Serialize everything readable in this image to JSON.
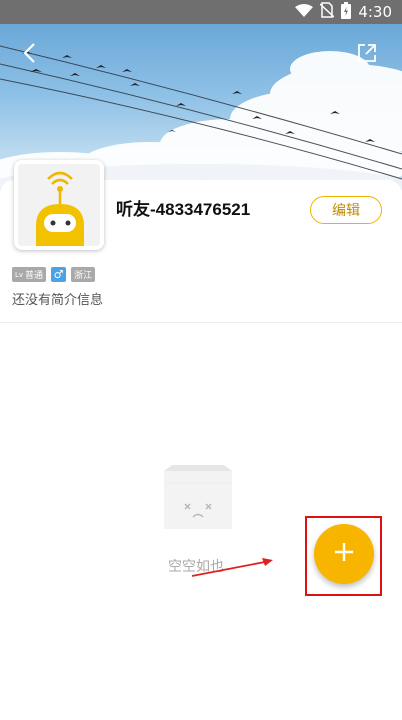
{
  "status_bar": {
    "time": "4:30",
    "icons": [
      "wifi-icon",
      "no-sim-icon",
      "battery-icon"
    ]
  },
  "topbar": {
    "back_icon": "chevron-left-icon",
    "share_icon": "share-icon"
  },
  "profile": {
    "username": "听友-4833476521",
    "edit_label": "编辑",
    "badges": {
      "level": "普通",
      "level_prefix": "Lv",
      "gender": "♂",
      "region": "浙江"
    },
    "bio": "还没有简介信息"
  },
  "empty_state": {
    "text": "空空如也"
  },
  "fab": {
    "label": "+"
  },
  "colors": {
    "accent": "#f7b500",
    "highlight": "#dd1111",
    "status_bar": "#6f6f6f"
  }
}
